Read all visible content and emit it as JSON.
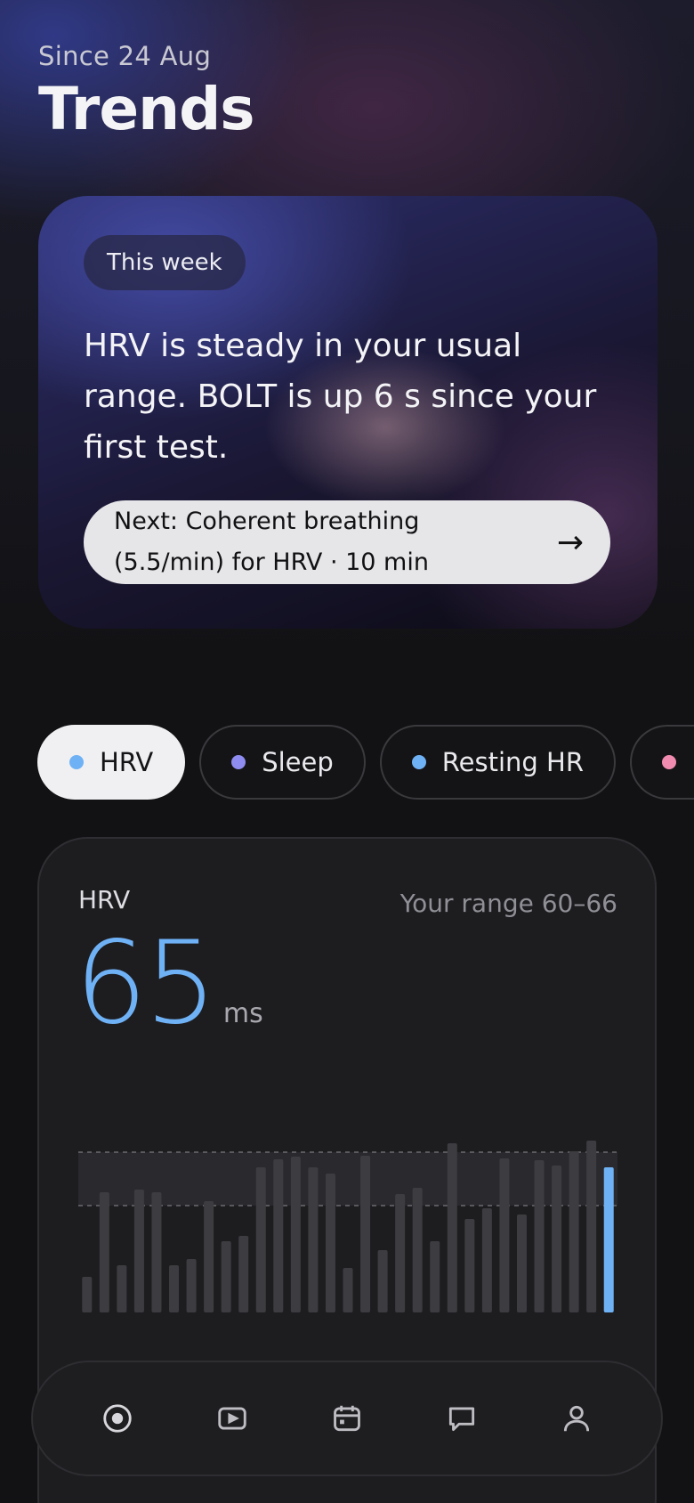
{
  "header": {
    "since": "Since 24 Aug",
    "title": "Trends"
  },
  "week_card": {
    "pill": "This week",
    "message": "HRV is steady in your usual range. BOLT is up 6 s since your first test.",
    "next_button": {
      "label": "Next: Coherent breathing (5.5/min) for HRV · 10 min",
      "arrow": "→"
    }
  },
  "metric_chips": [
    {
      "label": "HRV",
      "dot_color": "#6fb1f5",
      "active": true
    },
    {
      "label": "Sleep",
      "dot_color": "#8e8cf0",
      "active": false
    },
    {
      "label": "Resting HR",
      "dot_color": "#6fb1f5",
      "active": false
    },
    {
      "label": "",
      "dot_color": "#f28bb0",
      "active": false
    }
  ],
  "hrv_card": {
    "label": "HRV",
    "range_text": "Your range 60–66",
    "value": "65",
    "unit": "ms"
  },
  "chart_data": {
    "type": "bar",
    "range_band": [
      60,
      66
    ],
    "ylim": [
      48,
      72
    ],
    "values": [
      52,
      61.5,
      53.3,
      61.8,
      61.5,
      53.3,
      54,
      60.5,
      56,
      56.6,
      64.3,
      65.2,
      65.5,
      64.3,
      63.6,
      53,
      65.6,
      55,
      61.3,
      62,
      56,
      67,
      58.5,
      59.7,
      65.3,
      59,
      65.1,
      64.5,
      66.1,
      67.3,
      64.3
    ],
    "highlight_last": true,
    "colors": {
      "bar": "#3d3d41",
      "highlight": "#6fb1f5",
      "band": "#2a2a2e"
    }
  },
  "navbar": {
    "items": [
      {
        "name": "home",
        "icon": "target-icon",
        "active": true
      },
      {
        "name": "sessions",
        "icon": "play-icon",
        "active": false
      },
      {
        "name": "calendar",
        "icon": "calendar-icon",
        "active": false
      },
      {
        "name": "chat",
        "icon": "chat-icon",
        "active": false
      },
      {
        "name": "profile",
        "icon": "profile-icon",
        "active": false
      }
    ]
  }
}
